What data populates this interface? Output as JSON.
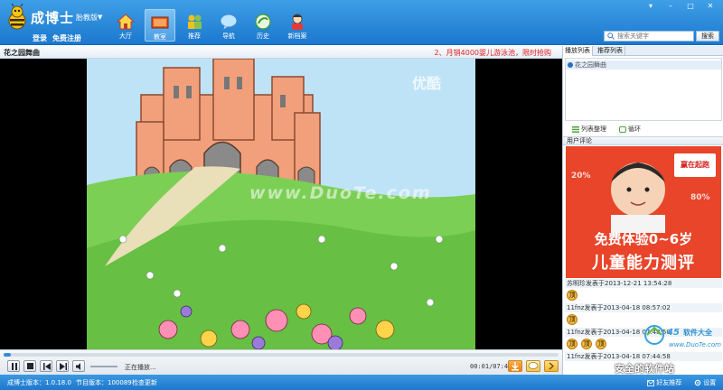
{
  "app": {
    "name": "成博士",
    "tagline": "胎教版",
    "login": "登录",
    "register": "免费注册"
  },
  "nav": {
    "tabs": [
      {
        "label": "大厅",
        "icon": "home-icon"
      },
      {
        "label": "教室",
        "icon": "classroom-icon"
      },
      {
        "label": "推荐",
        "icon": "recommend-icon"
      },
      {
        "label": "导航",
        "icon": "navigation-icon"
      },
      {
        "label": "历史",
        "icon": "history-icon"
      },
      {
        "label": "新档案",
        "icon": "profile-icon"
      }
    ],
    "active_index": 1
  },
  "window": {
    "controls": [
      "▾",
      "–",
      "□",
      "✕"
    ]
  },
  "search": {
    "placeholder": "搜索关键字",
    "button": "搜索"
  },
  "video": {
    "title": "花之园舞曲",
    "promo": "2、月销4000婴儿游泳池，限时抢购",
    "watermark_youku": "优酷",
    "watermark_duote": "www.DuoTe.com"
  },
  "player": {
    "status": "正在播放...",
    "time": "00:01/07:43",
    "progress": 0.01
  },
  "side": {
    "tabs": [
      "播放列表",
      "推荐列表"
    ],
    "playlist_item": "花之园舞曲",
    "list_tools": [
      "列表整理",
      "循环"
    ],
    "comments_header": "用户评论",
    "ad": {
      "brand": "赢在起跑",
      "stat1": "20%",
      "stat2": "80%",
      "line1": "免费体验0~6岁",
      "line2": "儿童能力测评"
    },
    "comments": [
      {
        "header": "苏明珍发表于2013-12-21 13:54:28",
        "badges": [
          "顶"
        ]
      },
      {
        "header": "11fnz发表于2013-04-18 08:57:02",
        "badges": [
          "顶"
        ]
      },
      {
        "header": "11fnz发表于2013-04-18 07:48:50",
        "badges": [
          "顶",
          "顶",
          "顶"
        ]
      },
      {
        "header": "11fnz发表于2013-04-18 07:44:58",
        "badges": []
      }
    ],
    "site_logo": {
      "num": "45",
      "text": "软件大全",
      "url": "www.DuoTe.com"
    },
    "site_tagline": "安全的软件站"
  },
  "statusbar": {
    "version": "成博士版本：1.0.18.0",
    "program_version": "节目版本：100089",
    "check_update": "检查更新",
    "share": "好友推荐",
    "settings": "设置"
  },
  "colors": {
    "header_blue": "#1b78cf",
    "promo_red": "#e02020",
    "ad_red": "#e63a1c"
  }
}
